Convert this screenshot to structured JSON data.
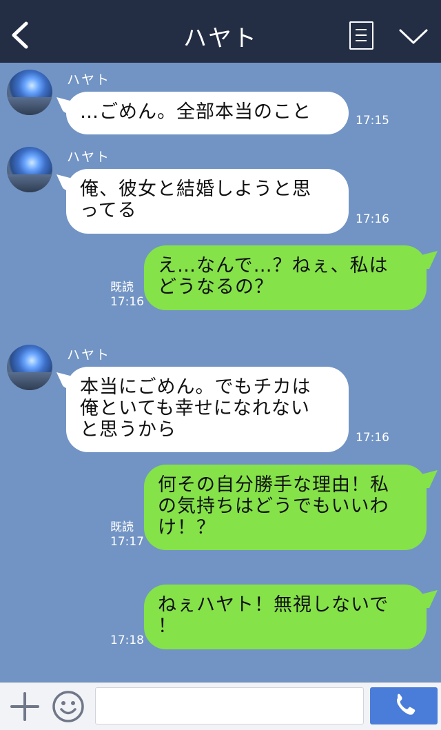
{
  "header": {
    "title": "ハヤト",
    "back_icon": "chevron-left-icon",
    "menu_icon": "menu-list-icon",
    "expand_icon": "chevron-down-icon"
  },
  "messages": [
    {
      "side": "left",
      "sender": "ハヤト",
      "lines": [
        "…ごめん。全部本当のこと"
      ],
      "time": "17:15"
    },
    {
      "side": "left",
      "sender": "ハヤト",
      "lines": [
        "俺、彼女と結婚しようと思",
        "ってる"
      ],
      "time": "17:16"
    },
    {
      "side": "right",
      "read": "既読",
      "lines": [
        "え…なんで…？ねぇ、私は",
        "どうなるの？"
      ],
      "time": "17:16"
    },
    {
      "side": "left",
      "sender": "ハヤト",
      "lines": [
        "本当にごめん。でもチカは",
        "俺といても幸せになれない",
        "と思うから"
      ],
      "time": "17:16"
    },
    {
      "side": "right",
      "read": "既読",
      "lines": [
        "何その自分勝手な理由！私",
        "の気持ちはどうでもいいわ",
        "け！？"
      ],
      "time": "17:17"
    },
    {
      "side": "right",
      "lines": [
        "ねぇハヤト！無視しないで",
        "！"
      ],
      "time": "17:18"
    }
  ],
  "input": {
    "value": "",
    "plus_icon": "plus-icon",
    "emoji_icon": "smiley-icon",
    "call_icon": "phone-icon"
  },
  "colors": {
    "header_bg": "#232e45",
    "chat_bg": "#7294c4",
    "left_bubble": "#ffffff",
    "right_bubble": "#85e249",
    "call_button": "#4a7dd9"
  }
}
